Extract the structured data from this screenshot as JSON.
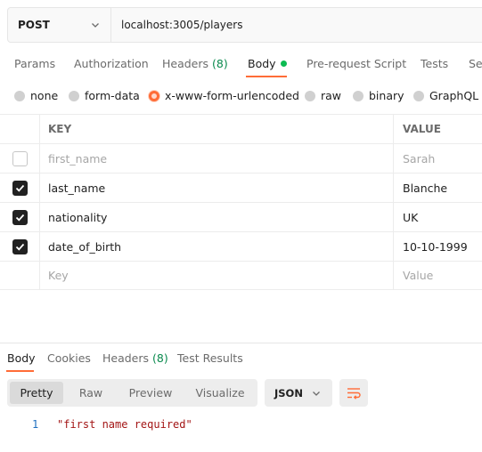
{
  "request": {
    "method": "POST",
    "url": "localhost:3005/players"
  },
  "tabs": [
    {
      "label": "Params"
    },
    {
      "label": "Authorization"
    },
    {
      "label": "Headers",
      "count": "(8)"
    },
    {
      "label": "Body"
    },
    {
      "label": "Pre-request Script"
    },
    {
      "label": "Tests"
    },
    {
      "label": "Se"
    }
  ],
  "body_types": [
    {
      "label": "none"
    },
    {
      "label": "form-data"
    },
    {
      "label": "x-www-form-urlencoded",
      "selected": true
    },
    {
      "label": "raw"
    },
    {
      "label": "binary"
    },
    {
      "label": "GraphQL"
    }
  ],
  "table": {
    "headers": {
      "key": "KEY",
      "value": "VALUE"
    },
    "rows": [
      {
        "checked": false,
        "key": "first_name",
        "value": "Sarah"
      },
      {
        "checked": true,
        "key": "last_name",
        "value": "Blanche"
      },
      {
        "checked": true,
        "key": "nationality",
        "value": "UK"
      },
      {
        "checked": true,
        "key": "date_of_birth",
        "value": "10-10-1999"
      }
    ],
    "placeholder": {
      "key": "Key",
      "value": "Value"
    }
  },
  "response": {
    "tabs": [
      {
        "label": "Body"
      },
      {
        "label": "Cookies"
      },
      {
        "label": "Headers",
        "count": "(8)"
      },
      {
        "label": "Test Results"
      }
    ],
    "view_modes": [
      {
        "label": "Pretty"
      },
      {
        "label": "Raw"
      },
      {
        "label": "Preview"
      },
      {
        "label": "Visualize"
      }
    ],
    "format": "JSON",
    "code": {
      "line": "1",
      "text": "\"first name required\""
    }
  },
  "colors": {
    "accent": "#ff6c37",
    "body_dot": "#0cbb52",
    "count": "#0a8a4e"
  }
}
